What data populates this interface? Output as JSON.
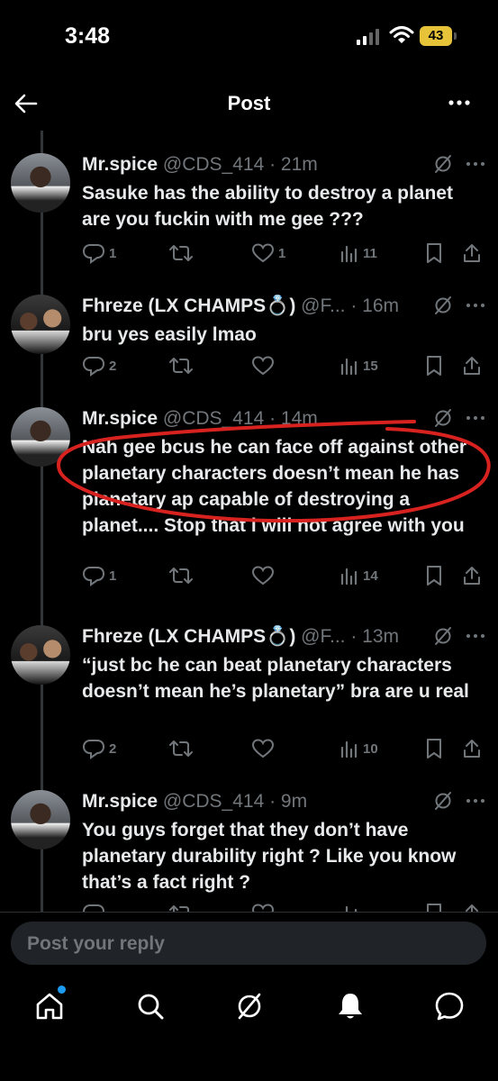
{
  "status": {
    "time": "3:48",
    "battery": "43"
  },
  "nav": {
    "title": "Post"
  },
  "posts": [
    {
      "name": "Mr.spice",
      "handle": "@CDS_414",
      "time": "· 21m",
      "text": "Sasuke has the ability to destroy a planet are you fuckin with me gee ???",
      "replies": "1",
      "likes": "1",
      "views": "11"
    },
    {
      "name": "Fhreze (LX CHAMPS💍)",
      "handle": "@F...",
      "time": "· 16m",
      "text": "bru yes easily lmao",
      "replies": "2",
      "likes": "",
      "views": "15"
    },
    {
      "name": "Mr.spice",
      "handle": "@CDS_414",
      "time": "· 14m",
      "text": "Nah gee bcus he can face off against other planetary characters doesn’t mean he has planetary ap capable of destroying a planet.... Stop that i will not agree with you",
      "replies": "1",
      "likes": "",
      "views": "14"
    },
    {
      "name": "Fhreze (LX CHAMPS💍)",
      "handle": "@F...",
      "time": "· 13m",
      "text": "“just bc he can beat planetary characters doesn’t mean he’s planetary” bra are u real",
      "replies": "2",
      "likes": "",
      "views": "10"
    },
    {
      "name": "Mr.spice",
      "handle": "@CDS_414",
      "time": "· 9m",
      "text": "You guys forget that they don’t have planetary durability right ? Like you know that’s a fact right ?",
      "replies": "",
      "likes": "",
      "views": ""
    }
  ],
  "reply": {
    "placeholder": "Post your reply"
  },
  "tabs": [
    "home-icon",
    "search-icon",
    "grok-icon",
    "notifications-icon",
    "messages-icon"
  ],
  "colors": {
    "accent": "#1d9bf0",
    "annotation": "#d8221f",
    "battery": "#e7c33a"
  }
}
